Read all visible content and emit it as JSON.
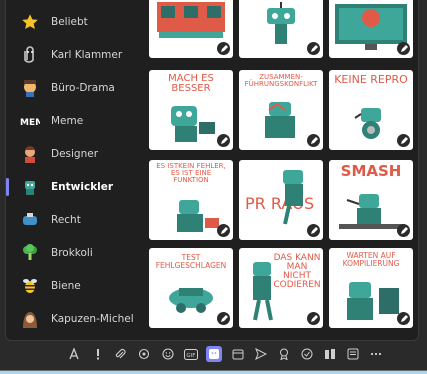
{
  "categories": [
    {
      "label": "Beliebt",
      "icon": "star-icon"
    },
    {
      "label": "Karl Klammer",
      "icon": "paperclip-icon"
    },
    {
      "label": "Büro-Drama",
      "icon": "drama-icon"
    },
    {
      "label": "Meme",
      "icon": "meme-icon"
    },
    {
      "label": "Designer",
      "icon": "designer-icon"
    },
    {
      "label": "Entwickler",
      "icon": "developer-icon",
      "active": true
    },
    {
      "label": "Recht",
      "icon": "law-icon"
    },
    {
      "label": "Brokkoli",
      "icon": "broccoli-icon"
    },
    {
      "label": "Biene",
      "icon": "bee-icon"
    },
    {
      "label": "Kapuzen-Michel",
      "icon": "hooded-person-icon"
    }
  ],
  "stickers": [
    {
      "caption": ""
    },
    {
      "caption": ""
    },
    {
      "caption": ""
    },
    {
      "caption": "MACH ES BESSER"
    },
    {
      "caption": "ZUSAMMEN-FÜHRUNGSKONFLIKT"
    },
    {
      "caption": "KEINE REPRO"
    },
    {
      "caption": "ES ISTKEIN FEHLER, ES IST EINE FUNKTION"
    },
    {
      "caption": "PR RAUS"
    },
    {
      "caption": "SMASH"
    },
    {
      "caption": "TEST FEHLGESCHLAGEN"
    },
    {
      "caption": "DAS KANN MAN NICHT CODIEREN"
    },
    {
      "caption": "WARTEN AUF KOMPILIERUNG"
    }
  ],
  "toolbar_icons": [
    "format-icon",
    "priority-icon",
    "attach-icon",
    "loop-icon",
    "emoji-icon",
    "gif-icon",
    "sticker-icon",
    "schedule-icon",
    "send-icon",
    "praise-icon",
    "approvals-icon",
    "tasks-icon",
    "notes-icon",
    "more-icon"
  ],
  "colors": {
    "accent": "#7f85f5",
    "caption": "#e05a48",
    "robot": "#3fa79a"
  }
}
